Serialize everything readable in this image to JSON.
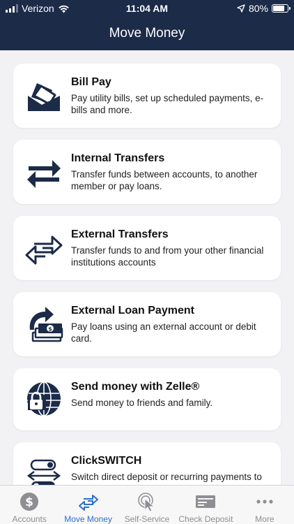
{
  "status_bar": {
    "carrier": "Verizon",
    "time": "11:04 AM",
    "battery": "80%"
  },
  "header": {
    "title": "Move Money"
  },
  "colors": {
    "header_bg": "#1b2b48",
    "icon_navy": "#1b2b48",
    "active_tab": "#2f6fc7",
    "inactive_tab": "#8e8e93"
  },
  "cards": [
    {
      "icon": "bill-pay-icon",
      "title": "Bill Pay",
      "desc": "Pay utility bills, set up scheduled payments, e-bills and more."
    },
    {
      "icon": "internal-transfer-icon",
      "title": "Internal Transfers",
      "desc": "Transfer funds between accounts, to another member or pay loans."
    },
    {
      "icon": "external-transfer-icon",
      "title": "External Transfers",
      "desc": "Transfer funds to and from your other financial institutions accounts"
    },
    {
      "icon": "loan-payment-icon",
      "title": "External Loan Payment",
      "desc": "Pay loans using an external account or debit card."
    },
    {
      "icon": "zelle-globe-lock-icon",
      "title": "Send money with Zelle®",
      "desc": "Send money to friends and family."
    },
    {
      "icon": "clickswitch-icon",
      "title": "ClickSWITCH",
      "desc": "Switch direct deposit or recurring payments to affinity"
    }
  ],
  "tabs": [
    {
      "icon": "dollar-coin-icon",
      "label": "Accounts",
      "active": false
    },
    {
      "icon": "transfer-arrows-icon",
      "label": "Move Money",
      "active": true
    },
    {
      "icon": "touch-pointer-icon",
      "label": "Self-Service",
      "active": false
    },
    {
      "icon": "check-icon",
      "label": "Check Deposit",
      "active": false
    },
    {
      "icon": "more-dots-icon",
      "label": "More",
      "active": false
    }
  ]
}
